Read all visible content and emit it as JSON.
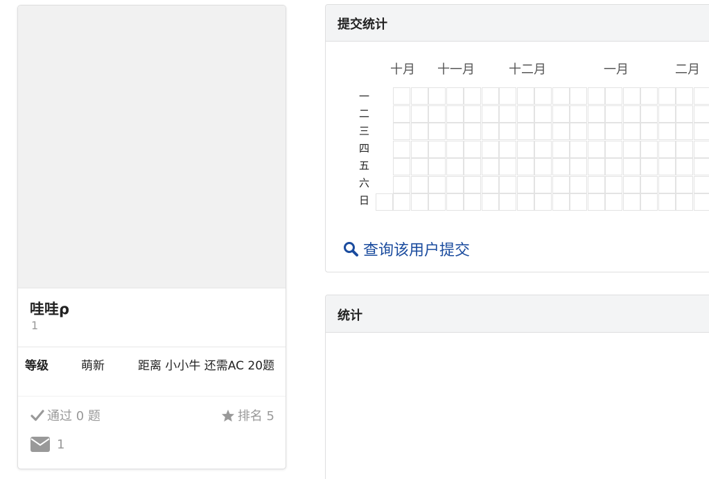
{
  "profile": {
    "username": "哇哇ρ",
    "sub": "1",
    "rank_label": "等级",
    "rank_value": "萌新",
    "rank_next": "距离 小小牛 还需AC 20题",
    "passed": "通过 0 题",
    "ranking": "排名 5",
    "messages": "1"
  },
  "submit_panel": {
    "title": "提交统计",
    "months": [
      "十月",
      "十一月",
      "十二月",
      "一月",
      "二月"
    ],
    "weekdays": [
      "一",
      "二",
      "三",
      "四",
      "五",
      "六",
      "日"
    ],
    "query_link": "查询该用户提交"
  },
  "stats_panel": {
    "title": "统计"
  },
  "colors": {
    "link": "#1a4b9e",
    "muted": "#999999",
    "header_bg": "#f3f4f5",
    "avatar_bg": "#f1f1f1"
  },
  "icons": [
    "check-icon",
    "star-icon",
    "envelope-icon",
    "search-icon"
  ]
}
